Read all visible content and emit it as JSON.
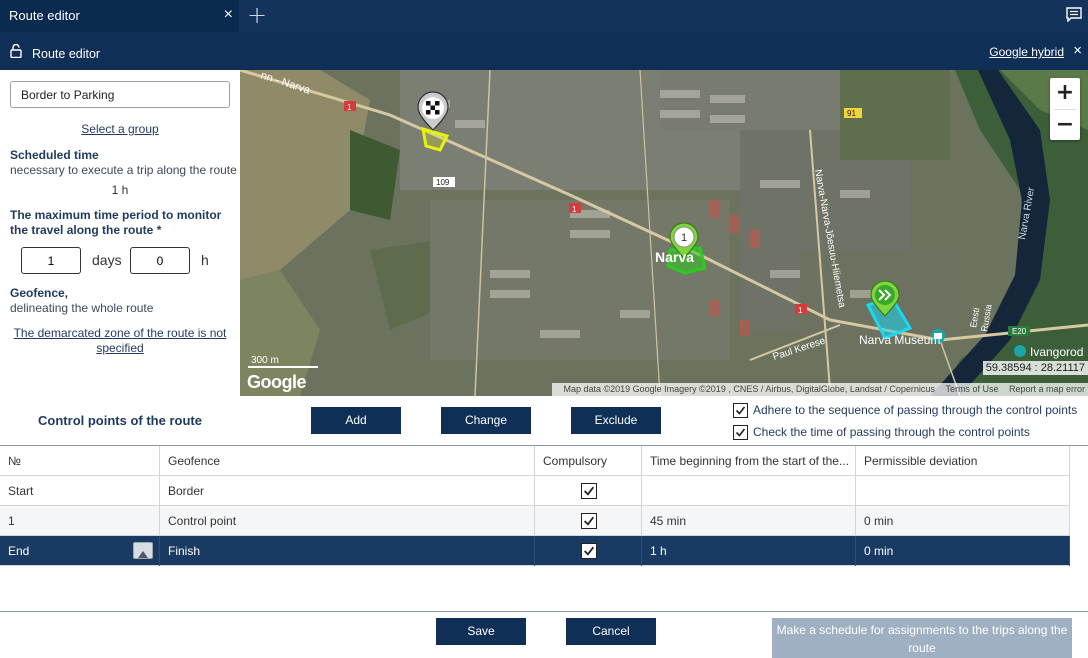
{
  "tabbar": {
    "tab_title": "Route editor",
    "close_symbol": "×",
    "add_symbol": "+"
  },
  "subheader": {
    "title": "Route editor",
    "map_type": "Google hybrid",
    "close_symbol": "×"
  },
  "form": {
    "route_name": "Border to Parking",
    "select_group": "Select a group",
    "scheduled_time_title": "Scheduled time",
    "scheduled_time_desc": "necessary to execute a trip along the route",
    "scheduled_time_value": "1 h",
    "max_period_title": "The maximum time period to monitor the travel along the route *",
    "days_value": "1",
    "days_label": "days",
    "hours_value": "0",
    "hours_label": "h",
    "geofence_title": "Geofence,",
    "geofence_desc": "delineating the whole route",
    "zone_link": "The demarcated zone of the route is not specified"
  },
  "map": {
    "zoom_in": "+",
    "zoom_out": "−",
    "scale": "300 m",
    "logo": "Google",
    "coords": "59.38594 : 28.21117",
    "attribution": "Map data ©2019 Google Imagery ©2019 , CNES / Airbus, DigitalGlobe, Landsat / Copernicus",
    "terms": "Terms of Use",
    "report": "Report a map error",
    "labels": {
      "narva_road": "nn - Narva",
      "road_1a": "1",
      "road_1b": "1",
      "road_1c": "1",
      "road_109": "109",
      "road_91": "91",
      "narva_city": "Narva",
      "narva_joesuu": "Narva-Narva-Jõesuu-Hiiemetsa",
      "paul_kerese": "Paul Kerese",
      "narva_museum": "Narva Museum",
      "ivangorod": "Ivangorod",
      "narva_river": "Narva River",
      "e20": "E20",
      "eesti": "Eesti",
      "russia": "Russia",
      "point_1": "1"
    }
  },
  "controls": {
    "title": "Control points of the route",
    "add": "Add",
    "change": "Change",
    "exclude": "Exclude",
    "check_sequence": "Adhere to the sequence of passing through the control points",
    "check_time": "Check the time of passing through the control points"
  },
  "table": {
    "headers": [
      "№",
      "Geofence",
      "Compulsory",
      "Time beginning from the start of the...",
      "Permissible deviation"
    ],
    "rows": [
      {
        "no": "Start",
        "geofence": "Border",
        "time": "",
        "deviation": ""
      },
      {
        "no": "1",
        "geofence": "Control point",
        "time": "45 min",
        "deviation": "0 min"
      },
      {
        "no": "End",
        "geofence": "Finish",
        "time": "1 h",
        "deviation": "0 min"
      }
    ]
  },
  "footer": {
    "save": "Save",
    "cancel": "Cancel",
    "schedule": "Make a schedule for assignments to the trips along the route"
  },
  "colors": {
    "header_dark": "#0f2f57",
    "accent_green": "#2ec91f",
    "accent_cyan": "#19d9f0",
    "accent_yellow": "#e8f20c"
  }
}
